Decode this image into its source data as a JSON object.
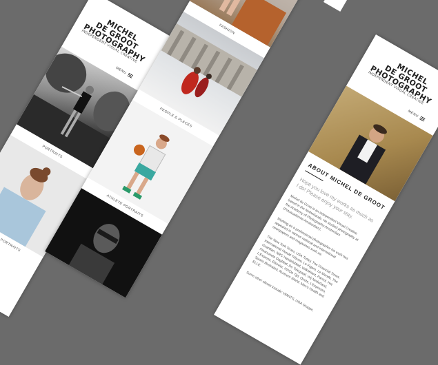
{
  "brand": {
    "line1": "MICHEL",
    "line2": "DE GROOT",
    "line3": "PHOTOGRAPHY",
    "tagline": "INDEPENDENT VISUAL CREATIVE"
  },
  "menu_label": "MENU",
  "captions": {
    "portraits": "PORTRAITS",
    "musician_portraits": "MUSICIAN PORTRAITS",
    "fashion": "FASHION",
    "people_places": "PEOPLE & PLACES",
    "athlete_portraits": "ATHLETE PORTRAITS"
  },
  "about": {
    "title": "ABOUT MICHEL DE GROOT",
    "intro": "Hope you love my works as much as I do! Please enjoy your stay.",
    "paragraphs": [
      "Michel de Groot is an independent Visual Creative based in the Netherlands. He studied photography at the Academy of Photography Amsterdam (Fotoacademie Amsterdam).",
      "Working as a professional photographer his work has appeared in various national and international newspapers and magazines such as:",
      "The New York Times, USA Today, The Financial Times, International Herald Tribune, Le Figaro, Le Monde, The Guardian, NRC Handelsblad, Volkskrant, Parool, Het Financieele Dagblad, De Telegraaf, Vrij Nederland, L'Express, Elsevier, HP/De Tijd, Quote, L'Espresso, Sports Illustrated, Runners World, Men's Health and ELLE.",
      "Some other clients include: WANTS, UGA Gruppe,"
    ]
  },
  "colors": {
    "background": "#6b6b6b",
    "page": "#ffffff",
    "text": "#222222",
    "muted": "#9a9a9a"
  }
}
